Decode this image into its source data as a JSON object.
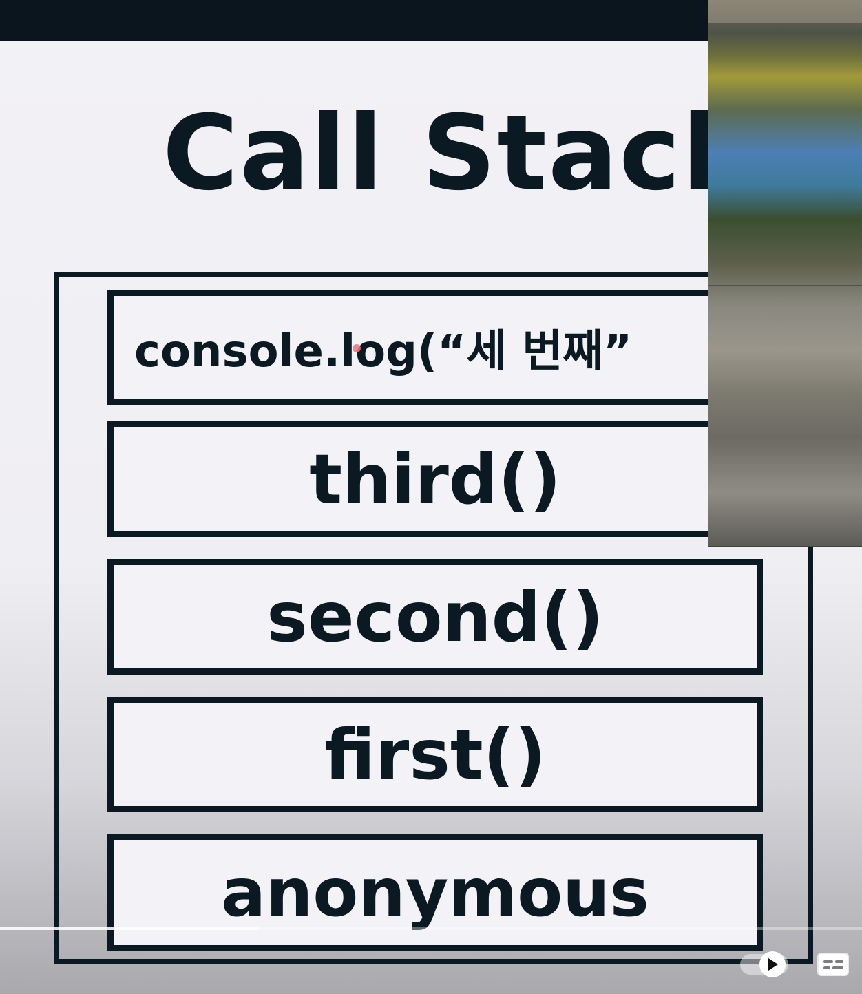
{
  "slide": {
    "title": "Call Stack",
    "frames": [
      {
        "label": "console.log(“세 번째”"
      },
      {
        "label": "third()"
      },
      {
        "label": "second()"
      },
      {
        "label": "first()"
      },
      {
        "label": "anonymous"
      }
    ]
  },
  "player": {
    "progress_fraction": 0.3,
    "icons": [
      "play-icon",
      "captions-icon"
    ]
  },
  "colors": {
    "ink": "#0b1a22",
    "slide_bg": "#f2f1f5",
    "top_bar": "#0b151d"
  }
}
